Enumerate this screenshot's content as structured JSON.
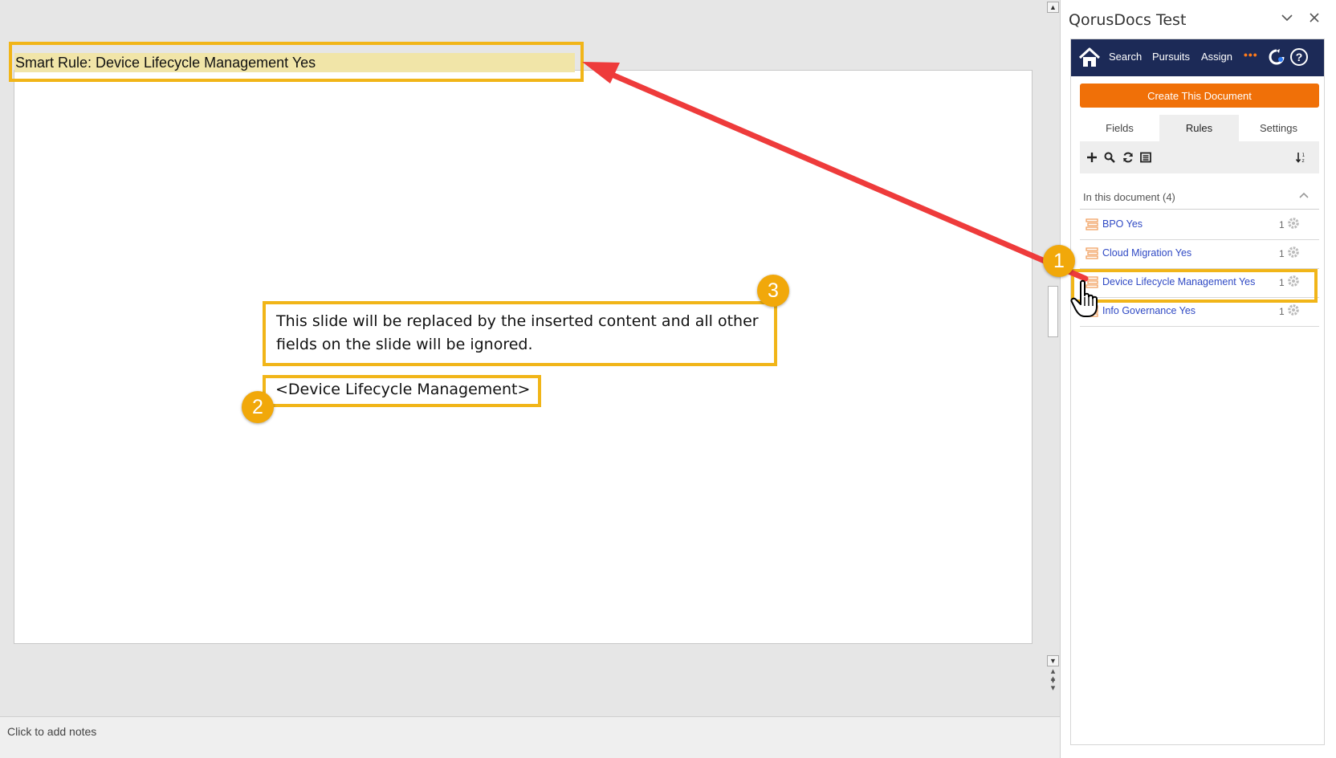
{
  "editor": {
    "notes_placeholder": "Click to add notes",
    "smart_rule_field": "Smart Rule: Device Lifecycle Management Yes",
    "callout_text": "This slide will be replaced by the inserted content and all other fields on the slide will be ignored.",
    "field_placeholder": "<Device Lifecycle Management>"
  },
  "badges": {
    "one": "1",
    "two": "2",
    "three": "3"
  },
  "pane": {
    "title": "QorusDocs Test",
    "nav": {
      "search": "Search",
      "pursuits": "Pursuits",
      "assign": "Assign",
      "more": "•••"
    },
    "create_button": "Create This Document",
    "tabs": [
      {
        "label": "Fields",
        "active": false
      },
      {
        "label": "Rules",
        "active": true
      },
      {
        "label": "Settings",
        "active": false
      }
    ],
    "toolbar_icons": [
      "add-icon",
      "search-icon",
      "refresh-icon",
      "list-icon",
      "sort-icon"
    ],
    "section_title": "In this document (4)",
    "rules": [
      {
        "label": "BPO Yes",
        "count": "1"
      },
      {
        "label": "Cloud Migration Yes",
        "count": "1"
      },
      {
        "label": "Device Lifecycle Management Yes",
        "count": "1"
      },
      {
        "label": "Info Governance Yes",
        "count": "1"
      }
    ]
  },
  "colors": {
    "annotation": "#f1b518",
    "navbar": "#1c2a57",
    "create_button": "#f07008",
    "rule_link": "#2f49c4",
    "arrow": "#ee3b3b"
  }
}
